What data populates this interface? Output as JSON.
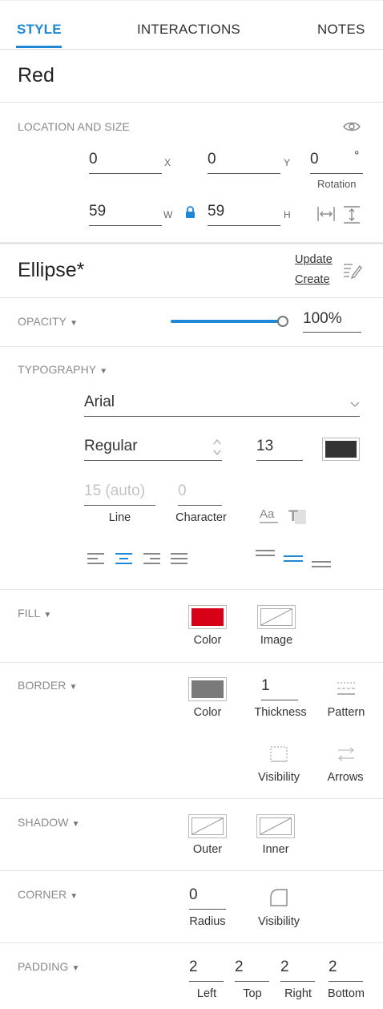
{
  "tabs": [
    {
      "label": "STYLE",
      "active": true
    },
    {
      "label": "INTERACTIONS",
      "active": false
    },
    {
      "label": "NOTES",
      "active": false
    }
  ],
  "element_name": "Red",
  "location_size": {
    "label": "LOCATION AND SIZE",
    "x": "0",
    "x_label": "X",
    "y": "0",
    "y_label": "Y",
    "rotation": "0",
    "rotation_unit": "°",
    "rotation_label": "Rotation",
    "w": "59",
    "w_label": "W",
    "h": "59",
    "h_label": "H"
  },
  "style": {
    "name": "Ellipse*",
    "update_label": "Update",
    "create_label": "Create"
  },
  "opacity": {
    "label": "OPACITY",
    "value": "100%",
    "level": 1.0
  },
  "typography": {
    "label": "TYPOGRAPHY",
    "font": "Arial",
    "weight": "Regular",
    "size": "13",
    "color": "#333333",
    "line_value": "15 (auto)",
    "line_label": "Line",
    "char_value": "0",
    "char_label": "Character"
  },
  "fill": {
    "label": "FILL",
    "color": "#d80017",
    "color_label": "Color",
    "image_label": "Image"
  },
  "border": {
    "label": "BORDER",
    "color": "#7a7a7a",
    "color_label": "Color",
    "thickness": "1",
    "thickness_label": "Thickness",
    "pattern_label": "Pattern",
    "visibility_label": "Visibility",
    "arrows_label": "Arrows"
  },
  "shadow": {
    "label": "SHADOW",
    "outer_label": "Outer",
    "inner_label": "Inner"
  },
  "corner": {
    "label": "CORNER",
    "radius": "0",
    "radius_label": "Radius",
    "visibility_label": "Visibility"
  },
  "padding": {
    "label": "PADDING",
    "left": "2",
    "left_label": "Left",
    "top": "2",
    "top_label": "Top",
    "right": "2",
    "right_label": "Right",
    "bottom": "2",
    "bottom_label": "Bottom"
  },
  "colors": {
    "accent": "#1e88d6",
    "fill_red": "#d80017"
  }
}
